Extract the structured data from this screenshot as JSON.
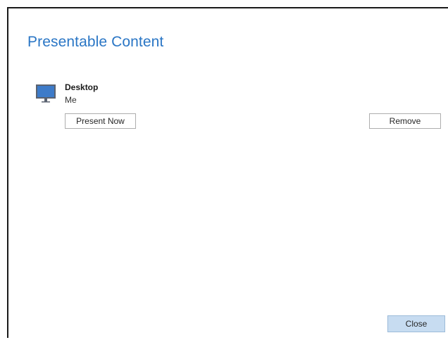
{
  "dialog": {
    "title": "Presentable Content",
    "close_glyph": "×",
    "close_button_label": "Close"
  },
  "content_items": [
    {
      "icon": "monitor-icon",
      "name": "Desktop",
      "owner": "Me",
      "present_label": "Present Now",
      "remove_label": "Remove"
    }
  ],
  "colors": {
    "title": "#2a76c5",
    "monitor_screen": "#3d7bc9",
    "close_button_bg": "#c7dcf1"
  }
}
